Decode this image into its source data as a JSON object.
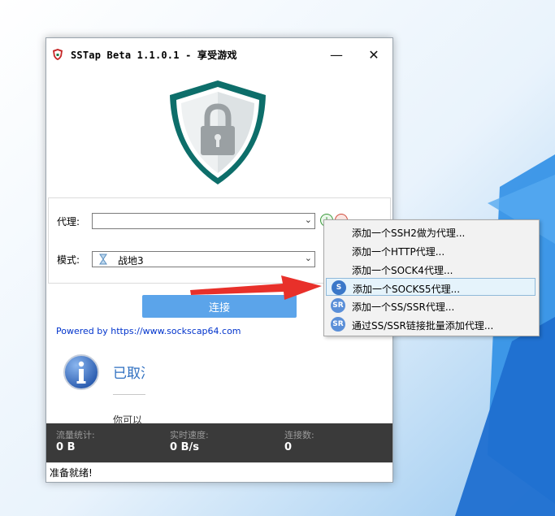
{
  "window": {
    "title": "SSTap Beta 1.1.0.1 - 享受游戏",
    "minimize_label": "—",
    "close_label": "✕"
  },
  "form": {
    "proxy_label": "代理:",
    "proxy_value": "",
    "mode_label": "模式:",
    "mode_value": "战地3"
  },
  "connect_label": "连接",
  "powered_by": "Powered by https://www.sockscap64.com",
  "notice": {
    "title": "已取消",
    "subtitle": "你可以"
  },
  "stats": {
    "traffic_label": "流量统计:",
    "traffic_value": "0 B",
    "speed_label": "实时速度:",
    "speed_value": "0 B/s",
    "connections_label": "连接数:",
    "connections_value": "0"
  },
  "status_text": "准备就绪!",
  "menu": {
    "items": [
      {
        "label": "添加一个SSH2做为代理...",
        "icon": "none"
      },
      {
        "label": "添加一个HTTP代理...",
        "icon": "none"
      },
      {
        "label": "添加一个SOCK4代理...",
        "icon": "none"
      },
      {
        "label": "添加一个SOCKS5代理...",
        "icon": "S"
      },
      {
        "label": "添加一个SS/SSR代理...",
        "icon": "SR"
      },
      {
        "label": "通过SS/SSR链接批量添加代理...",
        "icon": "SR"
      }
    ],
    "highlighted_index": 3
  },
  "colors": {
    "accent": "#5ba4ea",
    "shield": "#0f7a72",
    "stats_bg": "#3a3a3a",
    "arrow": "#e8302a"
  }
}
